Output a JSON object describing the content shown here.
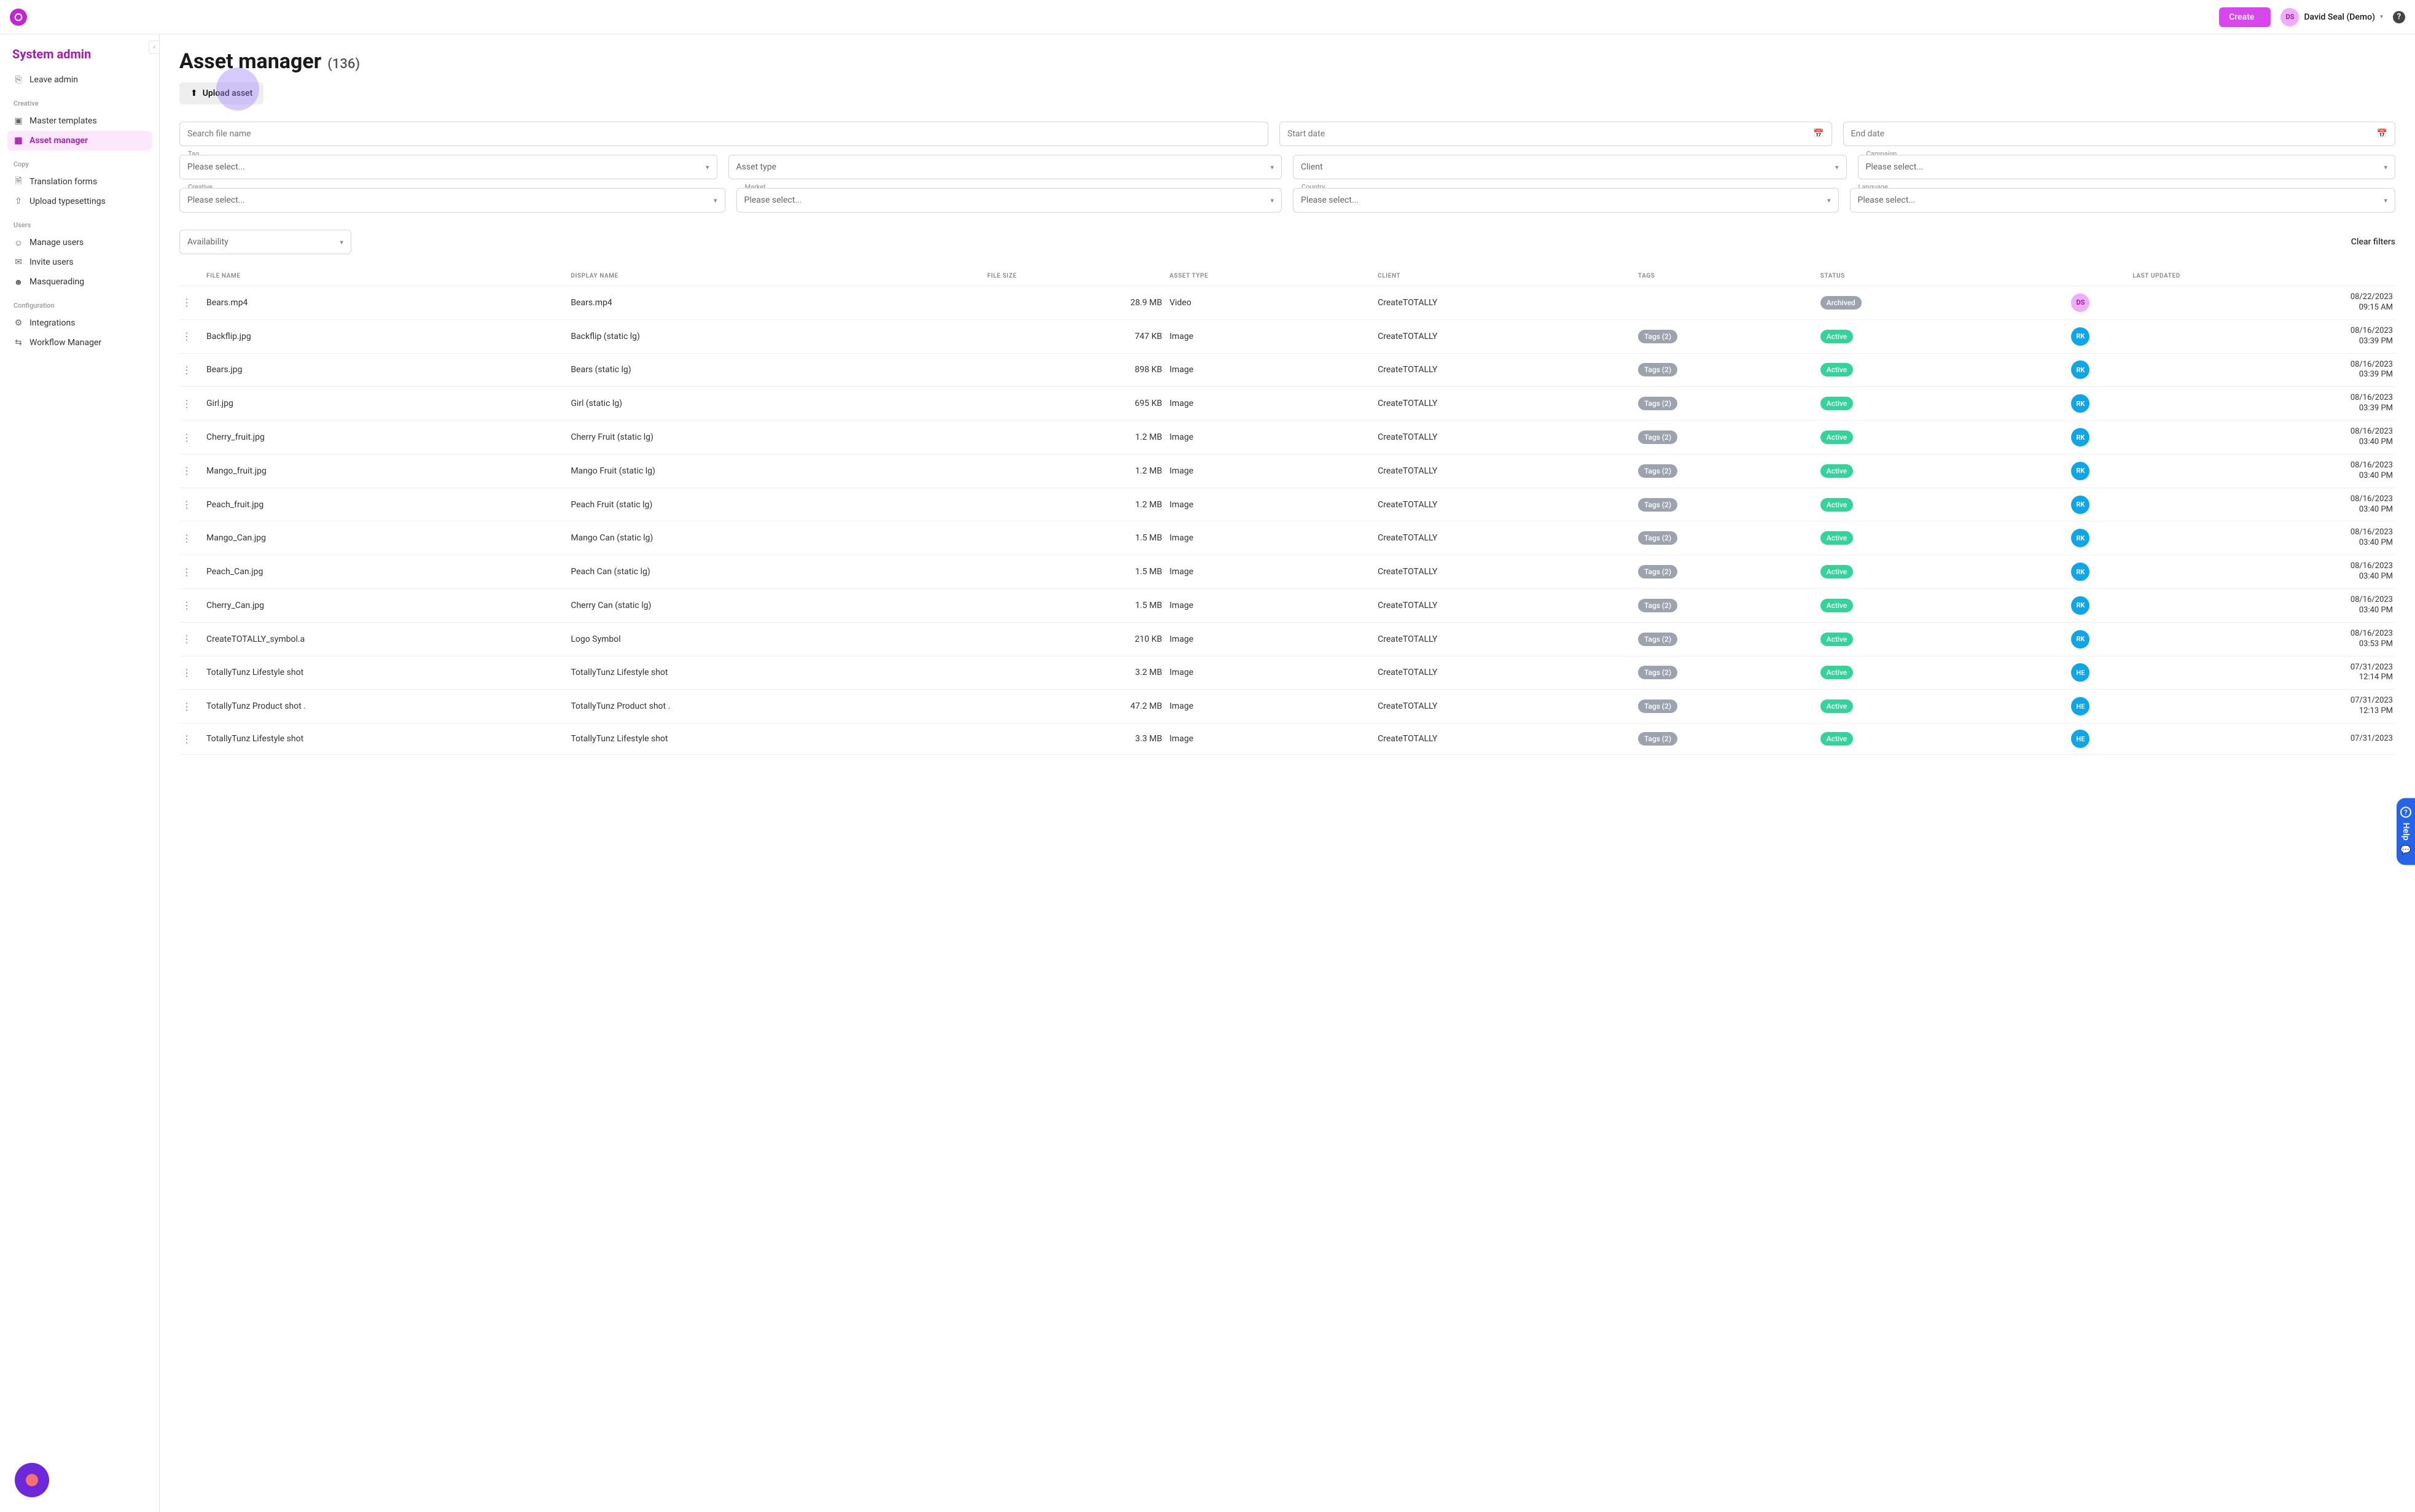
{
  "header": {
    "create_label": "Create",
    "user_initials": "DS",
    "user_name": "David Seal (Demo)"
  },
  "sidebar": {
    "title": "System admin",
    "leave_admin": "Leave admin",
    "sections": {
      "creative": "Creative",
      "copy": "Copy",
      "users": "Users",
      "configuration": "Configuration"
    },
    "items": {
      "master_templates": "Master templates",
      "asset_manager": "Asset manager",
      "translation_forms": "Translation forms",
      "upload_typesettings": "Upload typesettings",
      "manage_users": "Manage users",
      "invite_users": "Invite users",
      "masquerading": "Masquerading",
      "integrations": "Integrations",
      "workflow_manager": "Workflow Manager"
    }
  },
  "page": {
    "title": "Asset manager",
    "count": "(136)",
    "upload_label": "Upload asset"
  },
  "filters": {
    "search_placeholder": "Search file name",
    "start_date_placeholder": "Start date",
    "end_date_placeholder": "End date",
    "tag_label": "Tag",
    "tag_value": "Please select...",
    "asset_type_value": "Asset type",
    "client_value": "Client",
    "campaign_label": "Campaign",
    "campaign_value": "Please select...",
    "creative_label": "Creative",
    "creative_value": "Please select...",
    "market_label": "Market",
    "market_value": "Please select...",
    "country_label": "Country",
    "country_value": "Please select...",
    "language_label": "Language",
    "language_value": "Please select...",
    "availability_value": "Availability",
    "clear_filters": "Clear filters"
  },
  "table": {
    "headers": {
      "file_name": "FILE NAME",
      "display_name": "DISPLAY NAME",
      "file_size": "FILE SIZE",
      "asset_type": "ASSET TYPE",
      "client": "CLIENT",
      "tags": "TAGS",
      "status": "STATUS",
      "last_updated": "LAST UPDATED"
    },
    "rows": [
      {
        "file": "Bears.mp4",
        "display": "Bears.mp4",
        "size": "28.9 MB",
        "type": "Video",
        "client": "CreateTOTALLY",
        "tags": "",
        "status": "Archived",
        "avatar": "DS",
        "date": "08/22/2023",
        "time": "09:15 AM"
      },
      {
        "file": "Backflip.jpg",
        "display": "Backflip (static lg)",
        "size": "747 KB",
        "type": "Image",
        "client": "CreateTOTALLY",
        "tags": "Tags (2)",
        "status": "Active",
        "avatar": "RK",
        "date": "08/16/2023",
        "time": "03:39 PM"
      },
      {
        "file": "Bears.jpg",
        "display": "Bears (static lg)",
        "size": "898 KB",
        "type": "Image",
        "client": "CreateTOTALLY",
        "tags": "Tags (2)",
        "status": "Active",
        "avatar": "RK",
        "date": "08/16/2023",
        "time": "03:39 PM"
      },
      {
        "file": "Girl.jpg",
        "display": "Girl (static lg)",
        "size": "695 KB",
        "type": "Image",
        "client": "CreateTOTALLY",
        "tags": "Tags (2)",
        "status": "Active",
        "avatar": "RK",
        "date": "08/16/2023",
        "time": "03:39 PM"
      },
      {
        "file": "Cherry_fruit.jpg",
        "display": "Cherry Fruit (static lg)",
        "size": "1.2 MB",
        "type": "Image",
        "client": "CreateTOTALLY",
        "tags": "Tags (2)",
        "status": "Active",
        "avatar": "RK",
        "date": "08/16/2023",
        "time": "03:40 PM"
      },
      {
        "file": "Mango_fruit.jpg",
        "display": "Mango Fruit (static lg)",
        "size": "1.2 MB",
        "type": "Image",
        "client": "CreateTOTALLY",
        "tags": "Tags (2)",
        "status": "Active",
        "avatar": "RK",
        "date": "08/16/2023",
        "time": "03:40 PM"
      },
      {
        "file": "Peach_fruit.jpg",
        "display": "Peach Fruit (static lg)",
        "size": "1.2 MB",
        "type": "Image",
        "client": "CreateTOTALLY",
        "tags": "Tags (2)",
        "status": "Active",
        "avatar": "RK",
        "date": "08/16/2023",
        "time": "03:40 PM"
      },
      {
        "file": "Mango_Can.jpg",
        "display": "Mango Can (static lg)",
        "size": "1.5 MB",
        "type": "Image",
        "client": "CreateTOTALLY",
        "tags": "Tags (2)",
        "status": "Active",
        "avatar": "RK",
        "date": "08/16/2023",
        "time": "03:40 PM"
      },
      {
        "file": "Peach_Can.jpg",
        "display": "Peach Can (static lg)",
        "size": "1.5 MB",
        "type": "Image",
        "client": "CreateTOTALLY",
        "tags": "Tags (2)",
        "status": "Active",
        "avatar": "RK",
        "date": "08/16/2023",
        "time": "03:40 PM"
      },
      {
        "file": "Cherry_Can.jpg",
        "display": "Cherry Can (static lg)",
        "size": "1.5 MB",
        "type": "Image",
        "client": "CreateTOTALLY",
        "tags": "Tags (2)",
        "status": "Active",
        "avatar": "RK",
        "date": "08/16/2023",
        "time": "03:40 PM"
      },
      {
        "file": "CreateTOTALLY_symbol.a",
        "display": "Logo Symbol",
        "size": "210 KB",
        "type": "Image",
        "client": "CreateTOTALLY",
        "tags": "Tags (2)",
        "status": "Active",
        "avatar": "RK",
        "date": "08/16/2023",
        "time": "03:53 PM"
      },
      {
        "file": "TotallyTunz Lifestyle shot",
        "display": "TotallyTunz Lifestyle shot",
        "size": "3.2 MB",
        "type": "Image",
        "client": "CreateTOTALLY",
        "tags": "Tags (2)",
        "status": "Active",
        "avatar": "HE",
        "date": "07/31/2023",
        "time": "12:14 PM"
      },
      {
        "file": "TotallyTunz Product shot .",
        "display": "TotallyTunz Product shot .",
        "size": "47.2 MB",
        "type": "Image",
        "client": "CreateTOTALLY",
        "tags": "Tags (2)",
        "status": "Active",
        "avatar": "HE",
        "date": "07/31/2023",
        "time": "12:13 PM"
      },
      {
        "file": "TotallyTunz Lifestyle shot",
        "display": "TotallyTunz Lifestyle shot",
        "size": "3.3 MB",
        "type": "Image",
        "client": "CreateTOTALLY",
        "tags": "Tags (2)",
        "status": "Active",
        "avatar": "HE",
        "date": "07/31/2023",
        "time": ""
      }
    ]
  },
  "help_tab": "Help"
}
